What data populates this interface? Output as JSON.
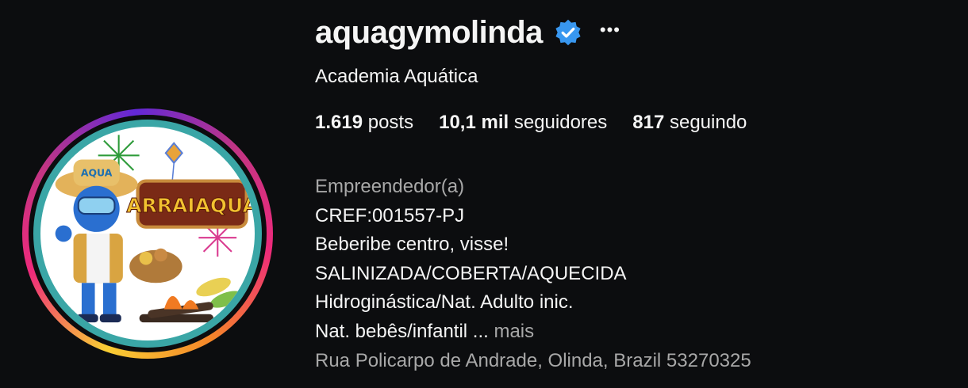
{
  "profile": {
    "username": "aquagymolinda",
    "verified": true,
    "more_options_icon": "ellipsis-icon",
    "name_label": "Academia Aquática",
    "stats": {
      "posts": {
        "value": "1.619",
        "label": "posts"
      },
      "followers": {
        "value": "10,1 mil",
        "label": "seguidores"
      },
      "following": {
        "value": "817",
        "label": "seguindo"
      }
    },
    "category": "Empreendedor(a)",
    "bio_lines": [
      "CREF:001557-PJ",
      "Beberibe centro, visse!",
      "SALINIZADA/COBERTA/AQUECIDA",
      "Hidroginástica/Nat. Adulto inic.",
      "Nat. bebês/infantil ..."
    ],
    "more_label": "mais",
    "address": "Rua Policarpo de Andrade, Olinda, Brazil 53270325",
    "avatar_text": "ARRAIAQUA",
    "avatar_hat_text": "AQUA"
  },
  "colors": {
    "background": "#0c0d0f",
    "text": "#f5f5f5",
    "muted": "#a8a8a8",
    "verified_blue": "#3897f0",
    "avatar_ring": "#3aa6a6"
  }
}
